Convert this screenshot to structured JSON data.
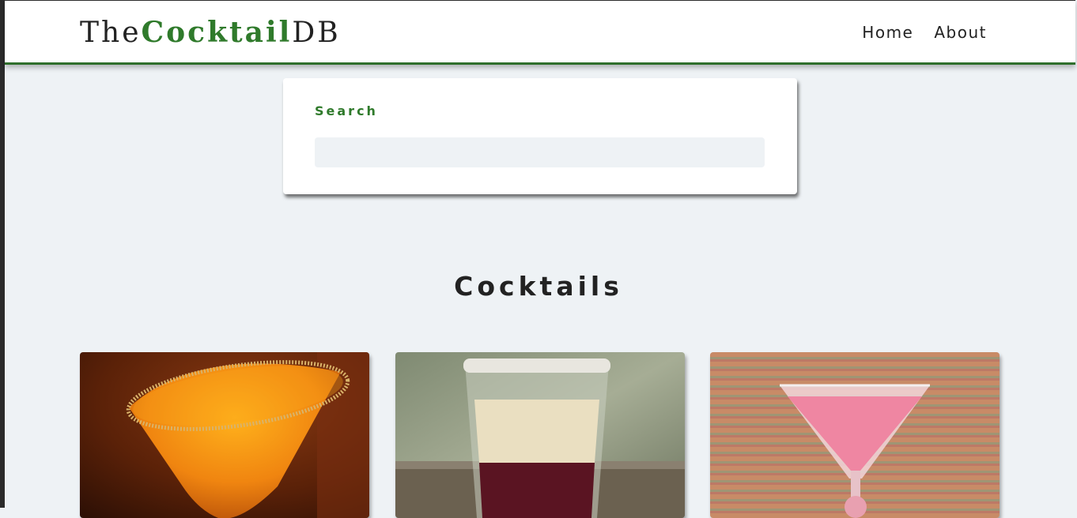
{
  "navbar": {
    "logo_prefix": "The",
    "logo_accent": "Cocktail",
    "logo_suffix": "DB",
    "links": [
      {
        "label": "Home"
      },
      {
        "label": "About"
      }
    ]
  },
  "search": {
    "label": "Search",
    "value": ""
  },
  "main": {
    "section_title": "Cocktails"
  },
  "cocktails": [
    {
      "image": "orange-martini-sugar-rim-photo"
    },
    {
      "image": "layered-shot-glass-photo"
    },
    {
      "image": "pink-martini-photo"
    }
  ],
  "colors": {
    "brand_green": "#2f7a2b",
    "navbar_border": "#2f6f2c",
    "page_background": "#eef2f5"
  }
}
